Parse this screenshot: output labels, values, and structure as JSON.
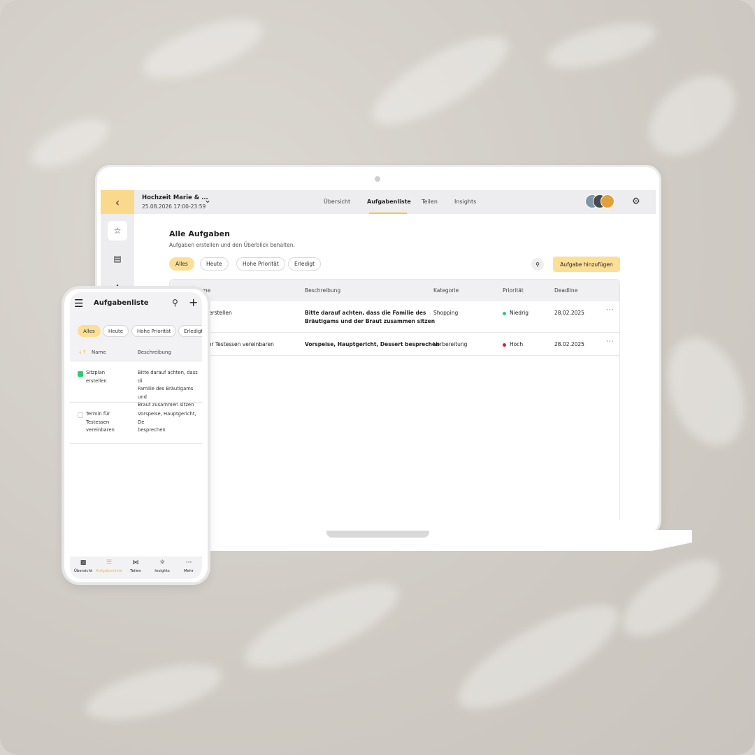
{
  "desktop": {
    "event": {
      "title": "Hochzeit Marie & ...",
      "date": "25.08.2026 17:00-23:59"
    },
    "nav_tabs": [
      {
        "label": "Übersicht"
      },
      {
        "label": "Aufgabenliste"
      },
      {
        "label": "Teilen"
      },
      {
        "label": "Insights"
      }
    ],
    "active_tab": "Aufgabenliste",
    "page_title": "Alle Aufgaben",
    "page_subtitle": "Aufgaben erstellen und den Überblick behalten.",
    "filters": [
      "Alles",
      "Heute",
      "Hohe Priorität",
      "Erledigt"
    ],
    "active_filter": "Alles",
    "add_button": "Aufgabe hinzufügen",
    "columns": [
      "Name",
      "Beschreibung",
      "Kategorie",
      "Priorität",
      "Deadline"
    ],
    "rows": [
      {
        "name": "erstellen",
        "description_line1": "Bitte darauf achten, dass die Familie des",
        "description_line2": "Bräutigams und der Braut zusammen sitzen",
        "category": "Shopping",
        "priority": "Niedrig",
        "priority_color": "#2ecc71",
        "deadline": "28.02.2025"
      },
      {
        "name": "für Testessen vereinbaren",
        "description_line1": "Vorspeise, Hauptgericht, Dessert besprechen",
        "category": "Vorbereitung",
        "priority": "Hoch",
        "priority_color": "#d9251c",
        "deadline": "28.02.2025"
      }
    ]
  },
  "mobile": {
    "title": "Aufgabenliste",
    "filters": [
      "Alles",
      "Heute",
      "Hohe Priorität",
      "Erledigt"
    ],
    "active_filter": "Alles",
    "columns": [
      "Name",
      "Beschreibung"
    ],
    "rows": [
      {
        "name_line1": "Sitzplan",
        "name_line2": "erstellen",
        "checked": true,
        "desc_line1": "Bitte darauf achten, dass di",
        "desc_line2": "Familie des Bräutigams und",
        "desc_line3": "Braut zusammen sitzen"
      },
      {
        "name_line1": "Termin für",
        "name_line2": "Testessen",
        "name_line3": "vereinbaren",
        "checked": false,
        "desc_line1": "Vorspeise, Hauptgericht, De",
        "desc_line2": "besprechen"
      }
    ],
    "bottom_nav": [
      {
        "label": "Übersicht",
        "icon": "calendar-icon"
      },
      {
        "label": "Aufgabenliste",
        "icon": "list-icon"
      },
      {
        "label": "Teilen",
        "icon": "share-icon"
      },
      {
        "label": "Insights",
        "icon": "lightbulb-icon"
      },
      {
        "label": "Mehr",
        "icon": "more-icon"
      }
    ],
    "active_nav": "Aufgabenliste"
  },
  "colors": {
    "accent": "#fbdf97",
    "accent_dark": "#f5c451",
    "background": "#d8d4cd"
  }
}
